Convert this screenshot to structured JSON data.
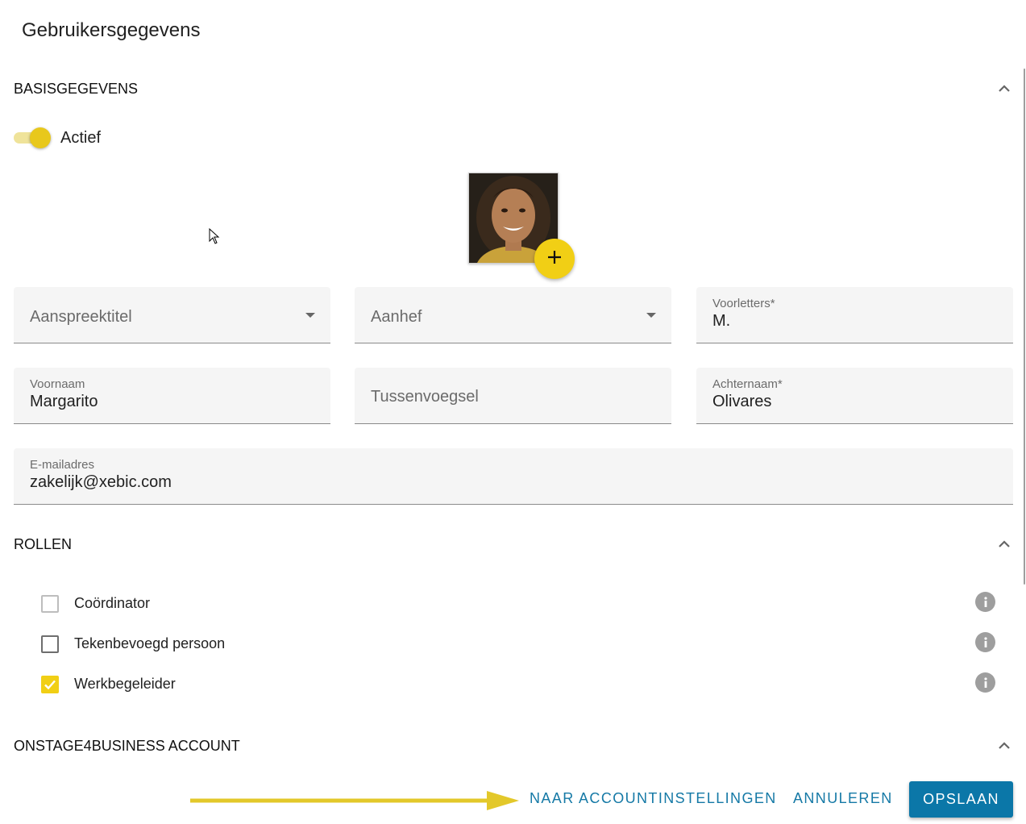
{
  "dialog": {
    "title": "Gebruikersgegevens"
  },
  "sections": {
    "basis": {
      "title": "BASISGEGEVENS"
    },
    "rollen": {
      "title": "ROLLEN"
    },
    "account": {
      "title": "ONSTAGE4BUSINESS ACCOUNT"
    }
  },
  "status": {
    "label": "Actief",
    "enabled": true
  },
  "photo": {
    "add_icon": "plus-icon",
    "avatar": "user-photo"
  },
  "fields": {
    "aanspreektitel": {
      "placeholder": "Aanspreektitel",
      "value": ""
    },
    "aanhef": {
      "placeholder": "Aanhef",
      "value": ""
    },
    "voorletters": {
      "label": "Voorletters*",
      "value": "M."
    },
    "voornaam": {
      "label": "Voornaam",
      "value": "Margarito"
    },
    "tussenvoegsel": {
      "placeholder": "Tussenvoegsel",
      "value": ""
    },
    "achternaam": {
      "label": "Achternaam*",
      "value": "Olivares"
    },
    "email": {
      "label": "E-mailadres",
      "value": "zakelijk@xebic.com"
    }
  },
  "roles": [
    {
      "label": "Coördinator",
      "checked": false,
      "disabled": true
    },
    {
      "label": "Tekenbevoegd persoon",
      "checked": false,
      "disabled": false
    },
    {
      "label": "Werkbegeleider",
      "checked": true,
      "disabled": false
    }
  ],
  "actions": {
    "account_settings": "NAAR ACCOUNTINSTELLINGEN",
    "cancel": "ANNULEREN",
    "save": "OPSLAAN"
  },
  "colors": {
    "accent": "#f1cf15",
    "primary": "#0b77a8",
    "link": "#1579a6"
  }
}
